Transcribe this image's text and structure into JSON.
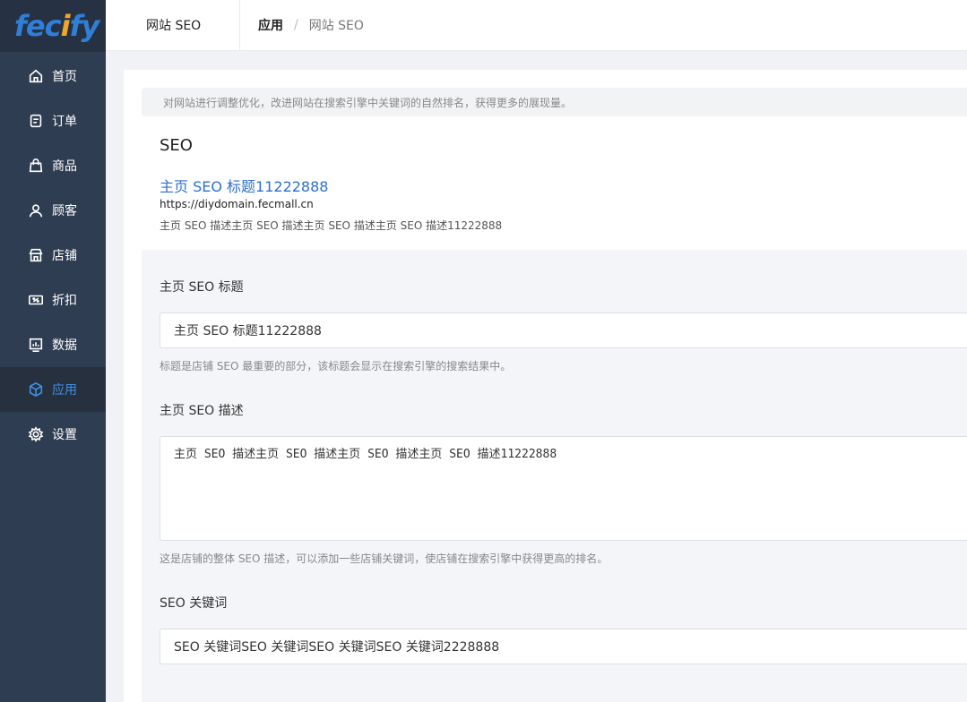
{
  "logo": {
    "text_part1": "fec",
    "text_o": "i",
    "text_part2": "fy"
  },
  "sidebar": {
    "items": [
      {
        "label": "首页",
        "icon": "home-icon"
      },
      {
        "label": "订单",
        "icon": "order-icon"
      },
      {
        "label": "商品",
        "icon": "bag-icon"
      },
      {
        "label": "顾客",
        "icon": "user-icon"
      },
      {
        "label": "店铺",
        "icon": "store-icon"
      },
      {
        "label": "折扣",
        "icon": "discount-icon"
      },
      {
        "label": "数据",
        "icon": "chart-icon"
      },
      {
        "label": "应用",
        "icon": "box-icon",
        "active": true
      },
      {
        "label": "设置",
        "icon": "gear-icon"
      }
    ]
  },
  "header": {
    "tab": "网站 SEO",
    "breadcrumb": [
      "应用",
      "网站 SEO"
    ],
    "separator": "/"
  },
  "page": {
    "notice": "对网站进行调整优化，改进网站在搜索引擎中关键词的自然排名，获得更多的展现量。",
    "section_title": "SEO",
    "preview": {
      "title": "主页 SEO 标题11222888",
      "url": "https://diydomain.fecmall.cn",
      "description": "主页 SEO 描述主页 SEO 描述主页 SEO 描述主页 SEO 描述11222888"
    }
  },
  "form": {
    "title_label": "主页 SEO 标题",
    "title_value": "主页 SEO 标题11222888",
    "title_help": "标题是店铺 SEO 最重要的部分，该标题会显示在搜索引擎的搜索结果中。",
    "desc_label": "主页 SEO 描述",
    "desc_value": "主页 SEO 描述主页 SEO 描述主页 SEO 描述主页 SEO 描述11222888",
    "desc_help": "这是店铺的整体 SEO 描述，可以添加一些店铺关键词，使店铺在搜索引擎中获得更高的排名。",
    "keywords_label": "SEO 关键词",
    "keywords_value": "SEO 关键词SEO 关键词SEO 关键词SEO 关键词2228888"
  },
  "colors": {
    "sidebar_bg": "#2f3d52",
    "accent": "#3f8fe8",
    "link": "#2c6fd1",
    "logo_blue": "#2f7fd6",
    "logo_orange": "#f2a629"
  }
}
